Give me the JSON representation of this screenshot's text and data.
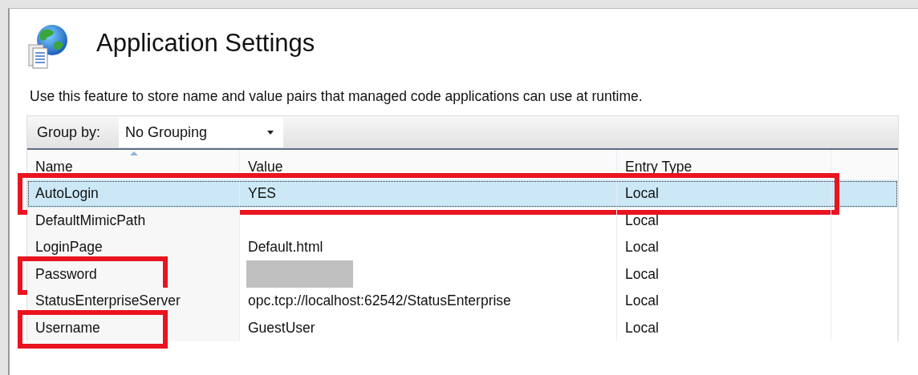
{
  "page": {
    "title": "Application Settings",
    "description": "Use this feature to store name and value pairs that managed code applications can use at runtime."
  },
  "toolbar": {
    "label": "Group by:",
    "dropdown": {
      "value": "No Grouping"
    }
  },
  "table": {
    "columns": [
      {
        "label": "Name",
        "sorted": true
      },
      {
        "label": "Value",
        "sorted": false
      },
      {
        "label": "Entry Type",
        "sorted": false
      }
    ],
    "rows": [
      {
        "name": "AutoLogin",
        "value": "YES",
        "entry_type": "Local",
        "selected": true,
        "row_highlighted": true,
        "name_highlighted": false
      },
      {
        "name": "DefaultMimicPath",
        "entry_type": "Local",
        "selected": false,
        "row_highlighted": false,
        "name_highlighted": false
      },
      {
        "name": "LoginPage",
        "value": "Default.html",
        "entry_type": "Local",
        "selected": false,
        "row_highlighted": false,
        "name_highlighted": false
      },
      {
        "name": "Password",
        "redacted": true,
        "entry_type": "Local",
        "selected": false,
        "row_highlighted": false,
        "name_highlighted": true
      },
      {
        "name": "StatusEnterpriseServer",
        "value": "opc.tcp://localhost:62542/StatusEnterprise",
        "entry_type": "Local",
        "selected": false,
        "row_highlighted": false,
        "name_highlighted": false
      },
      {
        "name": "Username",
        "value": "GuestUser",
        "entry_type": "Local",
        "selected": false,
        "row_highlighted": false,
        "name_highlighted": true
      }
    ]
  }
}
